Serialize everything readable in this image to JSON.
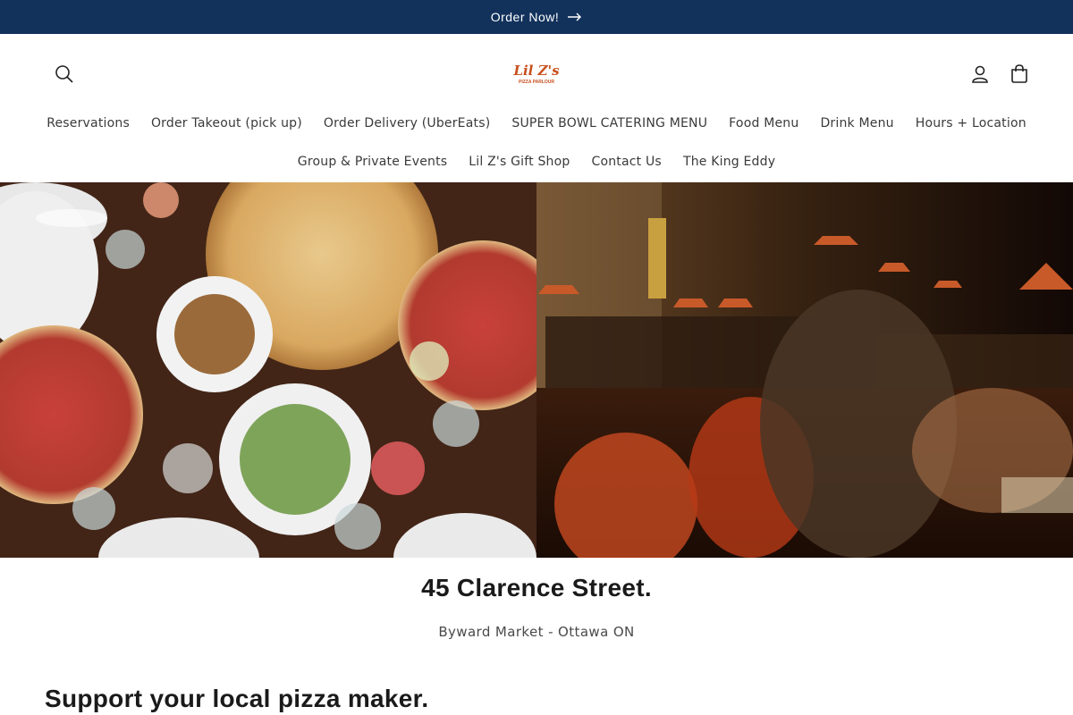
{
  "announcement": {
    "text": "Order Now!",
    "arrow_icon": "arrow-right-icon"
  },
  "header": {
    "search_icon": "search-icon",
    "account_icon": "account-icon",
    "cart_icon": "cart-icon",
    "logo": {
      "line1": "Lil Z's",
      "line2": "PIZZA PARLOUR"
    }
  },
  "nav": {
    "row1": [
      "Reservations",
      "Order Takeout (pick up)",
      "Order Delivery (UberEats)",
      "SUPER BOWL CATERING MENU",
      "Food Menu",
      "Drink Menu",
      "Hours + Location"
    ],
    "row2": [
      "Group & Private Events",
      "Lil Z's Gift Shop",
      "Contact Us",
      "The King Eddy"
    ]
  },
  "hero": {
    "left_image": "pizza-table-photo",
    "right_image": "restaurant-interior-photo"
  },
  "location": {
    "address": "45 Clarence Street.",
    "area": "Byward Market - Ottawa ON"
  },
  "support": {
    "heading": "Support your local pizza maker."
  },
  "colors": {
    "announcement_bg": "#12325c",
    "logo": "#c8501e",
    "text": "#121212"
  }
}
